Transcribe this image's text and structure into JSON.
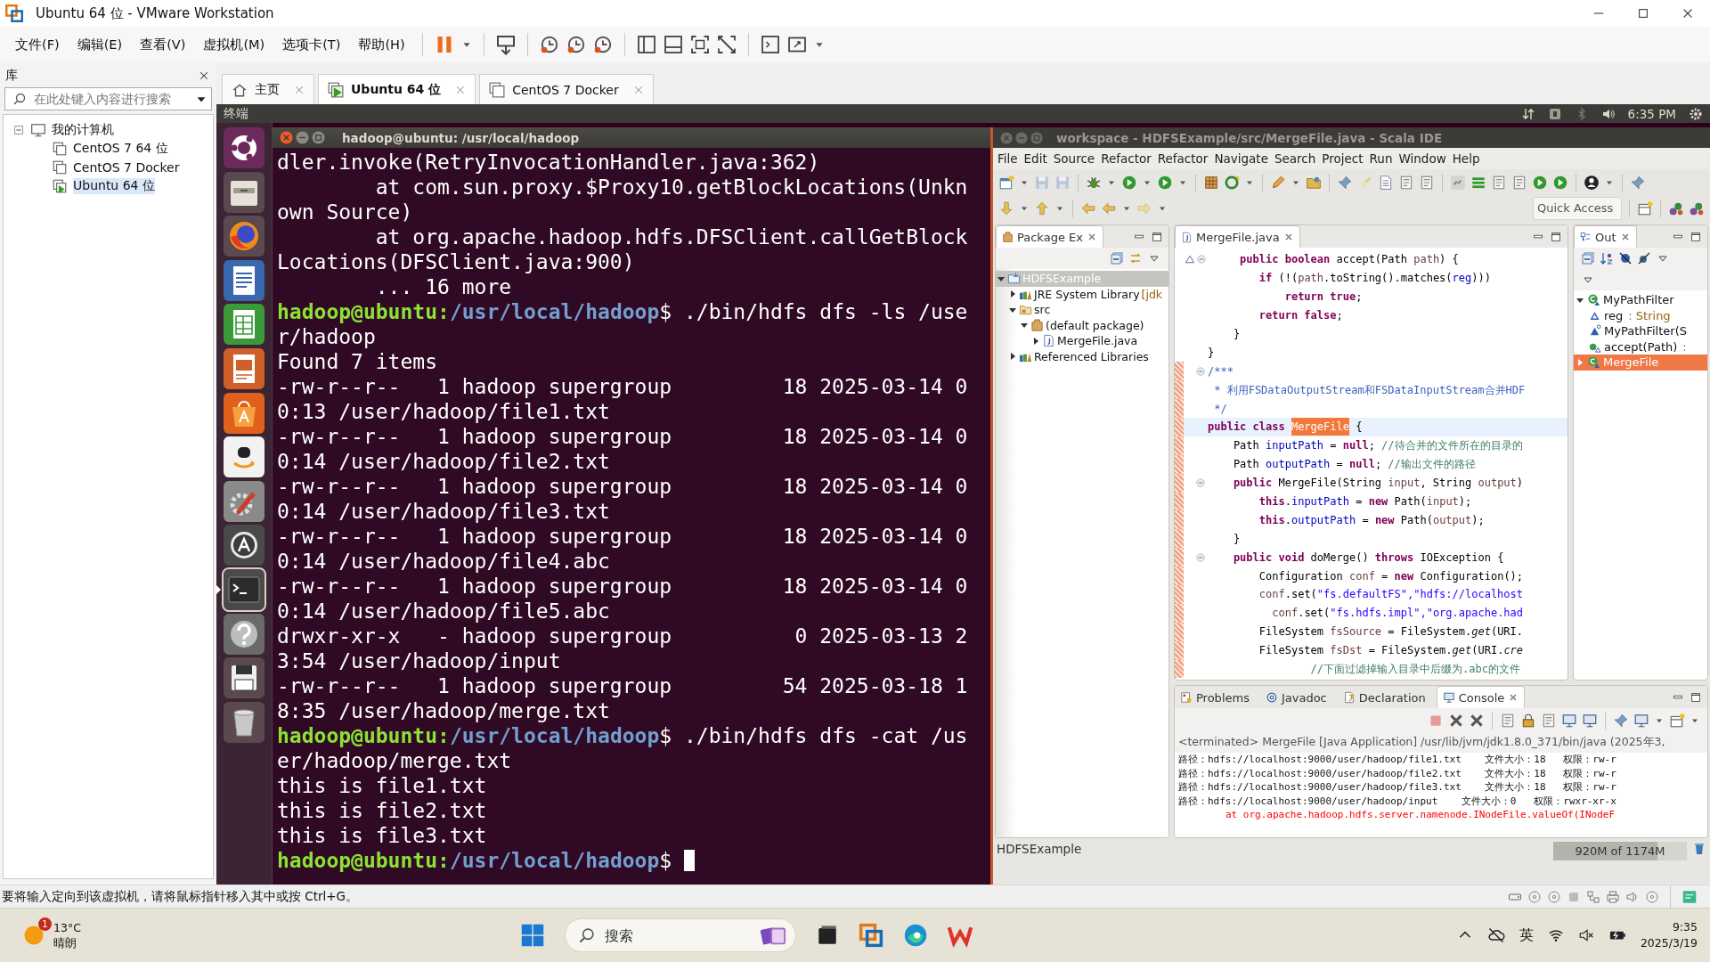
{
  "window": {
    "title": "Ubuntu 64 位 - VMware Workstation"
  },
  "menu": [
    "文件(F)",
    "编辑(E)",
    "查看(V)",
    "虚拟机(M)",
    "选项卡(T)",
    "帮助(H)"
  ],
  "library": {
    "title": "库",
    "search": {
      "placeholder": "在此处键入内容进行搜索"
    },
    "tree": [
      {
        "label": "我的计算机",
        "expanded": true,
        "selected": false,
        "children": [
          {
            "label": "CentOS 7 64 位",
            "selected": false,
            "running": false
          },
          {
            "label": "CentOS 7 Docker",
            "selected": false,
            "running": false
          },
          {
            "label": "Ubuntu 64 位",
            "selected": true,
            "running": true
          }
        ]
      }
    ]
  },
  "vm_tabs": [
    {
      "label": "主页",
      "kind": "home",
      "selected": false
    },
    {
      "label": "Ubuntu 64 位",
      "kind": "vm",
      "selected": true,
      "running": true
    },
    {
      "label": "CentOS 7 Docker",
      "kind": "vm",
      "selected": false,
      "running": false
    }
  ],
  "guest": {
    "top_bar": {
      "app_name": "终端",
      "clock": "6:35 PM"
    },
    "terminal": {
      "title": "hadoop@ubuntu: /usr/local/hadoop",
      "lines": [
        {
          "kind": "output",
          "text": "dler.invoke(RetryInvocationHandler.java:362)"
        },
        {
          "kind": "output",
          "text": "        at com.sun.proxy.$Proxy10.getBlockLocations(Unkn"
        },
        {
          "kind": "output",
          "text": "own Source)"
        },
        {
          "kind": "output",
          "text": "        at org.apache.hadoop.hdfs.DFSClient.callGetBlock"
        },
        {
          "kind": "output",
          "text": "Locations(DFSClient.java:900)"
        },
        {
          "kind": "output",
          "text": "        ... 16 more"
        },
        {
          "kind": "prompt",
          "user": "hadoop@ubuntu:",
          "path": "/usr/local/hadoop",
          "command": "$ ./bin/hdfs dfs -ls /use",
          "cursor": false
        },
        {
          "kind": "output",
          "text": "r/hadoop"
        },
        {
          "kind": "output",
          "text": "Found 7 items"
        },
        {
          "kind": "output",
          "text": "-rw-r--r--   1 hadoop supergroup         18 2025-03-14 0"
        },
        {
          "kind": "output",
          "text": "0:13 /user/hadoop/file1.txt"
        },
        {
          "kind": "output",
          "text": "-rw-r--r--   1 hadoop supergroup         18 2025-03-14 0"
        },
        {
          "kind": "output",
          "text": "0:14 /user/hadoop/file2.txt"
        },
        {
          "kind": "output",
          "text": "-rw-r--r--   1 hadoop supergroup         18 2025-03-14 0"
        },
        {
          "kind": "output",
          "text": "0:14 /user/hadoop/file3.txt"
        },
        {
          "kind": "output",
          "text": "-rw-r--r--   1 hadoop supergroup         18 2025-03-14 0"
        },
        {
          "kind": "output",
          "text": "0:14 /user/hadoop/file4.abc"
        },
        {
          "kind": "output",
          "text": "-rw-r--r--   1 hadoop supergroup         18 2025-03-14 0"
        },
        {
          "kind": "output",
          "text": "0:14 /user/hadoop/file5.abc"
        },
        {
          "kind": "output",
          "text": "drwxr-xr-x   - hadoop supergroup          0 2025-03-13 2"
        },
        {
          "kind": "output",
          "text": "3:54 /user/hadoop/input"
        },
        {
          "kind": "output",
          "text": "-rw-r--r--   1 hadoop supergroup         54 2025-03-18 1"
        },
        {
          "kind": "output",
          "text": "8:35 /user/hadoop/merge.txt"
        },
        {
          "kind": "prompt",
          "user": "hadoop@ubuntu:",
          "path": "/usr/local/hadoop",
          "command": "$ ./bin/hdfs dfs -cat /us",
          "cursor": false
        },
        {
          "kind": "output",
          "text": "er/hadoop/merge.txt"
        },
        {
          "kind": "output",
          "text": "this is file1.txt"
        },
        {
          "kind": "output",
          "text": "this is file2.txt"
        },
        {
          "kind": "output",
          "text": "this is file3.txt"
        },
        {
          "kind": "prompt",
          "user": "hadoop@ubuntu:",
          "path": "/usr/local/hadoop",
          "command": "$",
          "cursor": true
        }
      ]
    },
    "eclipse": {
      "title": "workspace - HDFSExample/src/MergeFile.java - Scala IDE",
      "menu": [
        "File",
        "Edit",
        "Source",
        "Refactor",
        "Refactor",
        "Navigate",
        "Search",
        "Project",
        "Run",
        "Window",
        "Help"
      ],
      "quick_access": {
        "placeholder": "Quick Access"
      },
      "package_explorer": {
        "tab": "Package Ex",
        "tree": [
          {
            "label": "HDFSExample",
            "kind": "project",
            "selected": true,
            "expanded": true,
            "children": [
              {
                "label": "JRE System Library",
                "decoration": "[jdk",
                "kind": "library",
                "selected": false,
                "expanded": false
              },
              {
                "label": "src",
                "kind": "source-folder",
                "selected": false,
                "expanded": true,
                "children": [
                  {
                    "label": "(default package)",
                    "kind": "package",
                    "selected": false,
                    "expanded": true,
                    "children": [
                      {
                        "label": "MergeFile.java",
                        "kind": "java-file",
                        "selected": false,
                        "expanded": false
                      }
                    ]
                  }
                ]
              },
              {
                "label": "Referenced Libraries",
                "kind": "library",
                "selected": false,
                "expanded": false
              }
            ]
          }
        ]
      },
      "editor": {
        "tab": "MergeFile.java",
        "lines": [
          {
            "override": true,
            "fold": true,
            "current": false,
            "changed": false,
            "segments": [
              {
                "kind": "k",
                "text": "     public boolean"
              },
              {
                "kind": "p",
                "text": " accept(Path "
              },
              {
                "kind": "v",
                "text": "path"
              },
              {
                "kind": "p",
                "text": ") {"
              }
            ]
          },
          {
            "override": false,
            "fold": false,
            "current": false,
            "changed": false,
            "segments": [
              {
                "kind": "k",
                "text": "        if"
              },
              {
                "kind": "p",
                "text": " (!("
              },
              {
                "kind": "v",
                "text": "path"
              },
              {
                "kind": "p",
                "text": ".toString().matches("
              },
              {
                "kind": "f",
                "text": "reg"
              },
              {
                "kind": "p",
                "text": ")))"
              }
            ]
          },
          {
            "override": false,
            "fold": false,
            "current": false,
            "changed": false,
            "segments": [
              {
                "kind": "k",
                "text": "            return true"
              },
              {
                "kind": "p",
                "text": ";"
              }
            ]
          },
          {
            "override": false,
            "fold": false,
            "current": false,
            "changed": false,
            "segments": [
              {
                "kind": "k",
                "text": "        return false"
              },
              {
                "kind": "p",
                "text": ";"
              }
            ]
          },
          {
            "override": false,
            "fold": false,
            "current": false,
            "changed": false,
            "segments": [
              {
                "kind": "p",
                "text": "    }"
              }
            ]
          },
          {
            "override": false,
            "fold": false,
            "current": false,
            "changed": false,
            "segments": [
              {
                "kind": "p",
                "text": "}"
              }
            ]
          },
          {
            "override": false,
            "fold": true,
            "current": false,
            "changed": true,
            "segments": [
              {
                "kind": "d",
                "text": "/***"
              }
            ]
          },
          {
            "override": false,
            "fold": false,
            "current": false,
            "changed": true,
            "segments": [
              {
                "kind": "d",
                "text": " * 利用FSDataOutputStream和FSDataInputStream合并HDF"
              }
            ]
          },
          {
            "override": false,
            "fold": false,
            "current": false,
            "changed": true,
            "segments": [
              {
                "kind": "d",
                "text": " */"
              }
            ]
          },
          {
            "override": false,
            "fold": false,
            "current": true,
            "changed": true,
            "segments": [
              {
                "kind": "k",
                "text": "public class "
              },
              {
                "kind": "h",
                "text": "MergeFile"
              },
              {
                "kind": "p",
                "text": " {"
              }
            ]
          },
          {
            "override": false,
            "fold": false,
            "current": false,
            "changed": true,
            "segments": [
              {
                "kind": "p",
                "text": "    Path "
              },
              {
                "kind": "f",
                "text": "inputPath"
              },
              {
                "kind": "p",
                "text": " = "
              },
              {
                "kind": "k",
                "text": "null"
              },
              {
                "kind": "p",
                "text": "; "
              },
              {
                "kind": "c",
                "text": "//待合并的文件所在的目录的"
              }
            ]
          },
          {
            "override": false,
            "fold": false,
            "current": false,
            "changed": true,
            "segments": [
              {
                "kind": "p",
                "text": "    Path "
              },
              {
                "kind": "f",
                "text": "outputPath"
              },
              {
                "kind": "p",
                "text": " = "
              },
              {
                "kind": "k",
                "text": "null"
              },
              {
                "kind": "p",
                "text": "; "
              },
              {
                "kind": "c",
                "text": "//输出文件的路径"
              }
            ]
          },
          {
            "override": false,
            "fold": true,
            "current": false,
            "changed": true,
            "segments": [
              {
                "kind": "k",
                "text": "    public"
              },
              {
                "kind": "p",
                "text": " MergeFile(String "
              },
              {
                "kind": "v",
                "text": "input"
              },
              {
                "kind": "p",
                "text": ", String "
              },
              {
                "kind": "v",
                "text": "output"
              },
              {
                "kind": "p",
                "text": ")"
              }
            ]
          },
          {
            "override": false,
            "fold": false,
            "current": false,
            "changed": true,
            "segments": [
              {
                "kind": "k",
                "text": "        this"
              },
              {
                "kind": "p",
                "text": "."
              },
              {
                "kind": "f",
                "text": "inputPath"
              },
              {
                "kind": "p",
                "text": " = "
              },
              {
                "kind": "k",
                "text": "new"
              },
              {
                "kind": "p",
                "text": " Path("
              },
              {
                "kind": "v",
                "text": "input"
              },
              {
                "kind": "p",
                "text": ");"
              }
            ]
          },
          {
            "override": false,
            "fold": false,
            "current": false,
            "changed": true,
            "segments": [
              {
                "kind": "k",
                "text": "        this"
              },
              {
                "kind": "p",
                "text": "."
              },
              {
                "kind": "f",
                "text": "outputPath"
              },
              {
                "kind": "p",
                "text": " = "
              },
              {
                "kind": "k",
                "text": "new"
              },
              {
                "kind": "p",
                "text": " Path("
              },
              {
                "kind": "v",
                "text": "output"
              },
              {
                "kind": "p",
                "text": ");"
              }
            ]
          },
          {
            "override": false,
            "fold": false,
            "current": false,
            "changed": true,
            "segments": [
              {
                "kind": "p",
                "text": "    }"
              }
            ]
          },
          {
            "override": false,
            "fold": true,
            "current": false,
            "changed": true,
            "segments": [
              {
                "kind": "k",
                "text": "    public void"
              },
              {
                "kind": "p",
                "text": " doMerge() "
              },
              {
                "kind": "k",
                "text": "throws"
              },
              {
                "kind": "p",
                "text": " IOException {"
              }
            ]
          },
          {
            "override": false,
            "fold": false,
            "current": false,
            "changed": true,
            "segments": [
              {
                "kind": "p",
                "text": "        Configuration "
              },
              {
                "kind": "v",
                "text": "conf"
              },
              {
                "kind": "p",
                "text": " = "
              },
              {
                "kind": "k",
                "text": "new"
              },
              {
                "kind": "p",
                "text": " Configuration();"
              }
            ]
          },
          {
            "override": false,
            "fold": false,
            "current": false,
            "changed": true,
            "segments": [
              {
                "kind": "v",
                "text": "        conf"
              },
              {
                "kind": "p",
                "text": ".set("
              },
              {
                "kind": "s",
                "text": "\"fs.defaultFS\","
              },
              {
                "kind": "s",
                "text": "\"hdfs://localhost"
              }
            ]
          },
          {
            "override": false,
            "fold": false,
            "current": false,
            "changed": true,
            "segments": [
              {
                "kind": "v",
                "text": "          conf"
              },
              {
                "kind": "p",
                "text": ".set("
              },
              {
                "kind": "s",
                "text": "\"fs.hdfs.impl\","
              },
              {
                "kind": "s",
                "text": "\"org.apache.had"
              }
            ]
          },
          {
            "override": false,
            "fold": false,
            "current": false,
            "changed": true,
            "segments": [
              {
                "kind": "p",
                "text": "        FileSystem "
              },
              {
                "kind": "v",
                "text": "fsSource"
              },
              {
                "kind": "p",
                "text": " = FileSystem."
              },
              {
                "kind": "i",
                "text": "get"
              },
              {
                "kind": "p",
                "text": "(URI."
              }
            ]
          },
          {
            "override": false,
            "fold": false,
            "current": false,
            "changed": true,
            "segments": [
              {
                "kind": "p",
                "text": "        FileSystem "
              },
              {
                "kind": "v",
                "text": "fsDst"
              },
              {
                "kind": "p",
                "text": " = FileSystem."
              },
              {
                "kind": "i",
                "text": "get"
              },
              {
                "kind": "p",
                "text": "(URI."
              },
              {
                "kind": "i",
                "text": "cre"
              }
            ]
          },
          {
            "override": false,
            "fold": false,
            "current": false,
            "changed": true,
            "segments": [
              {
                "kind": "c",
                "text": "                //下面过滤掉输入目录中后缀为.abc的文件"
              }
            ]
          }
        ]
      },
      "outline": {
        "tab": "Out",
        "tree": [
          {
            "label": "MyPathFilter",
            "kind": "class",
            "selected": false,
            "expanded": true,
            "children": [
              {
                "label": "reg",
                "type": ": String",
                "kind": "field",
                "selected": false
              },
              {
                "label": "MyPathFilter(S",
                "kind": "constructor",
                "selected": false
              },
              {
                "label": "accept(Path)",
                "type": ":",
                "kind": "method",
                "selected": false
              }
            ]
          },
          {
            "label": "MergeFile",
            "kind": "class",
            "selected": true,
            "expanded": false
          }
        ]
      },
      "bottom_tabs": [
        {
          "label": "Problems",
          "selected": false
        },
        {
          "label": "Javadoc",
          "selected": false
        },
        {
          "label": "Declaration",
          "selected": false
        },
        {
          "label": "Console",
          "selected": true
        }
      ],
      "console": {
        "header": "<terminated> MergeFile [Java Application] /usr/lib/jvm/jdk1.8.0_371/bin/java (2025年3,",
        "lines": [
          {
            "kind": "out",
            "text": "路径：hdfs://localhost:9000/user/hadoop/file1.txt    文件大小：18   权限：rw-r"
          },
          {
            "kind": "out",
            "text": "路径：hdfs://localhost:9000/user/hadoop/file2.txt    文件大小：18   权限：rw-r"
          },
          {
            "kind": "out",
            "text": "路径：hdfs://localhost:9000/user/hadoop/file3.txt    文件大小：18   权限：rw-r"
          },
          {
            "kind": "out",
            "text": "路径：hdfs://localhost:9000/user/hadoop/input    文件大小：0   权限：rwxr-xr-x"
          },
          {
            "kind": "err",
            "text": "        at org.apache.hadoop.hdfs.server.namenode.INodeFile.valueOf(INodeF"
          }
        ]
      },
      "status": {
        "selection": "HDFSExample",
        "heap": {
          "reading": "920M of 1174M",
          "level": 0.78
        }
      }
    }
  },
  "status_bar": {
    "message": "要将输入定向到该虚拟机，请将鼠标指针移入其中或按 Ctrl+G。"
  },
  "taskbar": {
    "weather": {
      "badge": "1",
      "temperature": "13°C",
      "condition": "晴朗"
    },
    "search": {
      "placeholder": "搜索"
    },
    "tray": {
      "ime": "英",
      "time": "9:35",
      "date": "2025/3/19"
    }
  }
}
